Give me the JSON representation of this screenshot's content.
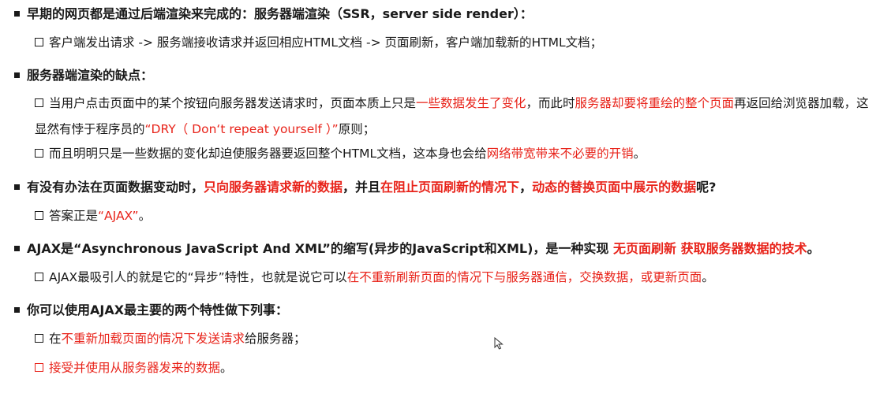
{
  "colors": {
    "text": "#1a1a1a",
    "highlight": "#e8231a",
    "background": "#ffffff"
  },
  "icons": {
    "level1_bullet": "filled-square-icon",
    "level2_bullet": "hollow-square-icon",
    "pointer": "mouse-cursor-icon"
  },
  "sections": [
    {
      "heading": [
        {
          "text": "早期的网页都是通过后端渲染来完成的：服务器端渲染（SSR，server side render）：",
          "red": false
        }
      ],
      "items": [
        [
          {
            "text": "客户端发出请求 -> 服务端接收请求并返回相应HTML文档 -> 页面刷新，客户端加载新的HTML文档；",
            "red": false
          }
        ]
      ]
    },
    {
      "heading": [
        {
          "text": "服务器端渲染的缺点：",
          "red": false
        }
      ],
      "items": [
        [
          {
            "text": "当用户点击页面中的某个按钮向服务器发送请求时，页面本质上只是",
            "red": false
          },
          {
            "text": "一些数据发生了变化",
            "red": true
          },
          {
            "text": "，而此时",
            "red": false
          },
          {
            "text": "服务器却要将重绘的整个页面",
            "red": true
          },
          {
            "text": "再返回给浏览器加载，这显然有悖于程序员的",
            "red": false
          },
          {
            "text": "“DRY（ Don‘t repeat yourself ）”",
            "red": true
          },
          {
            "text": "原则；",
            "red": false
          }
        ],
        [
          {
            "text": "而且明明只是一些数据的变化却迫使服务器要返回整个HTML文档，这本身也会给",
            "red": false
          },
          {
            "text": "网络带宽带来不必要的开销",
            "red": true
          },
          {
            "text": "。",
            "red": false
          }
        ]
      ]
    },
    {
      "heading": [
        {
          "text": "有没有办法在页面数据变动时，",
          "red": false
        },
        {
          "text": "只向服务器请求新的数据",
          "red": true
        },
        {
          "text": "，并且",
          "red": false
        },
        {
          "text": "在阻止页面刷新的情况下",
          "red": true
        },
        {
          "text": "，",
          "red": false
        },
        {
          "text": "动态的替换页面中展示的数据",
          "red": true
        },
        {
          "text": "呢?",
          "red": false
        }
      ],
      "items": [
        [
          {
            "text": "答案正是",
            "red": false
          },
          {
            "text": "“AJAX”",
            "red": true
          },
          {
            "text": "。",
            "red": false
          }
        ]
      ]
    },
    {
      "heading": [
        {
          "text": "AJAX是“Asynchronous JavaScript And XML”的缩写(异步的JavaScript和XML)，是一种实现 ",
          "red": false
        },
        {
          "text": "无页面刷新 获取服务器数据的技术",
          "red": true
        },
        {
          "text": "。",
          "red": false
        }
      ],
      "items": [
        [
          {
            "text": "AJAX最吸引人的就是它的“异步”特性，也就是说它可以",
            "red": false
          },
          {
            "text": "在不重新刷新页面的情况下与服务器通信，交换数据，或更新页面",
            "red": true
          },
          {
            "text": "。",
            "red": false
          }
        ]
      ]
    },
    {
      "heading": [
        {
          "text": "你可以使用AJAX最主要的两个特性做下列事：",
          "red": false
        }
      ],
      "items": [
        [
          {
            "text": "在",
            "red": false
          },
          {
            "text": "不重新加载页面的情况下发送请求",
            "red": true
          },
          {
            "text": "给服务器；",
            "red": false
          }
        ],
        [
          {
            "text": "接受并使用从服务器发来的数据",
            "red": true
          },
          {
            "text": "。",
            "red": false
          }
        ]
      ]
    }
  ]
}
